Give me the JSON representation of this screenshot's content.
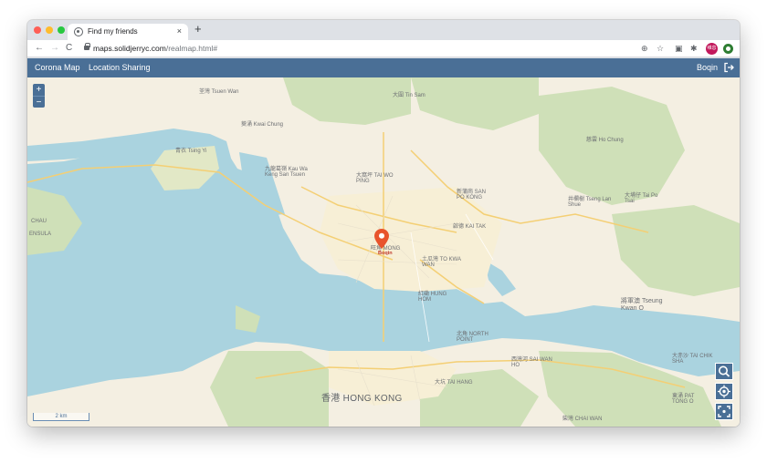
{
  "browser": {
    "tab_title": "Find my friends",
    "tab_close": "×",
    "new_tab": "+",
    "back": "←",
    "forward": "→",
    "reload": "C",
    "url_host": "maps.solidjerryc.com",
    "url_path": "/realmap.html#",
    "profile_initials": "维息"
  },
  "appbar": {
    "menu": [
      "Corona Map",
      "Location Sharing"
    ],
    "user": "Boqin",
    "color": "#4a6f96"
  },
  "map": {
    "zoom_in": "+",
    "zoom_out": "−",
    "scale": "2 km",
    "marker_label": "Boqin",
    "marker_color": "#e8542c",
    "labels": [
      "荃灣 Tsuen Wan",
      "大圍 Tin Sam",
      "葵涌 Kwai Chung",
      "青衣 Tsing Yi",
      "九龍葛嶺 Kau Wa Keng San Tsuen",
      "大窩坪 TAI WO PING",
      "新蒲崗 SAN PO KONG",
      "慈雲 Ho Chung",
      "井欄樹 Tseng Lan Shue",
      "大埔仔 Tai Po Tsai",
      "啟德 KAI TAK",
      "土瓜灣 TO KWA WAN",
      "旺角 MONG",
      "紅磡 HUNG HOM",
      "將軍澳 Tseung Kwan O",
      "北角 NORTH POINT",
      "香港 HONG KONG",
      "西灣河 SAI WAN HO",
      "大坑 TAI HANG",
      "大赤沙 TAI CHIK SHA",
      "柴灣 CHAI WAN",
      "東涌 PAT TONG O",
      "CHAU",
      "ENSULA"
    ]
  }
}
